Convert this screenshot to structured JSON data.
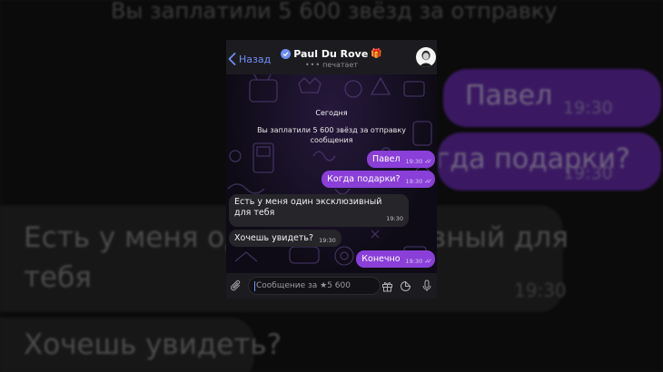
{
  "header": {
    "back_label": "Назад",
    "contact_name": "Paul Du Rove",
    "status_text": "печатает"
  },
  "chat": {
    "date_label": "Сегодня",
    "service_message": "Вы заплатили 5 600 звёзд за отправку сообщения",
    "messages": [
      {
        "direction": "out",
        "text": "Павел",
        "time": "19:30",
        "read": true
      },
      {
        "direction": "out",
        "text": "Когда подарки?",
        "time": "19:30",
        "read": true
      },
      {
        "direction": "in",
        "text": "Есть у меня один эксклюзивный для тебя",
        "time": "19:30"
      },
      {
        "direction": "in",
        "text": "Хочешь увидеть?",
        "time": "19:30"
      },
      {
        "direction": "out",
        "text": "Конечно",
        "time": "19:30",
        "read": true
      }
    ]
  },
  "input": {
    "placeholder": "Сообщение за ★5 600"
  },
  "background": {
    "line_top": "Вы заплатили 5 600 звёзд за отправку",
    "bubble_1_text": "Павел",
    "bubble_1_time": "19:30",
    "bubble_2_text": "Когда подарки?",
    "bubble_2_time": "19:30",
    "in_line_1": "Есть у меня один эксклюзивный для",
    "in_line_2": "тебя",
    "in_time": "19:30",
    "in2_text": "Хочешь увидеть?"
  },
  "colors": {
    "accent": "#6f8ff5",
    "outgoing_bubble": "#8a3fd8",
    "incoming_bubble": "#25252a",
    "header_bg": "#1c1c20"
  },
  "icons": [
    "chevron-left-icon",
    "verified-badge-icon",
    "gift-emoji-icon",
    "paperclip-icon",
    "gift-icon",
    "sticker-icon",
    "microphone-icon",
    "double-check-icon"
  ]
}
